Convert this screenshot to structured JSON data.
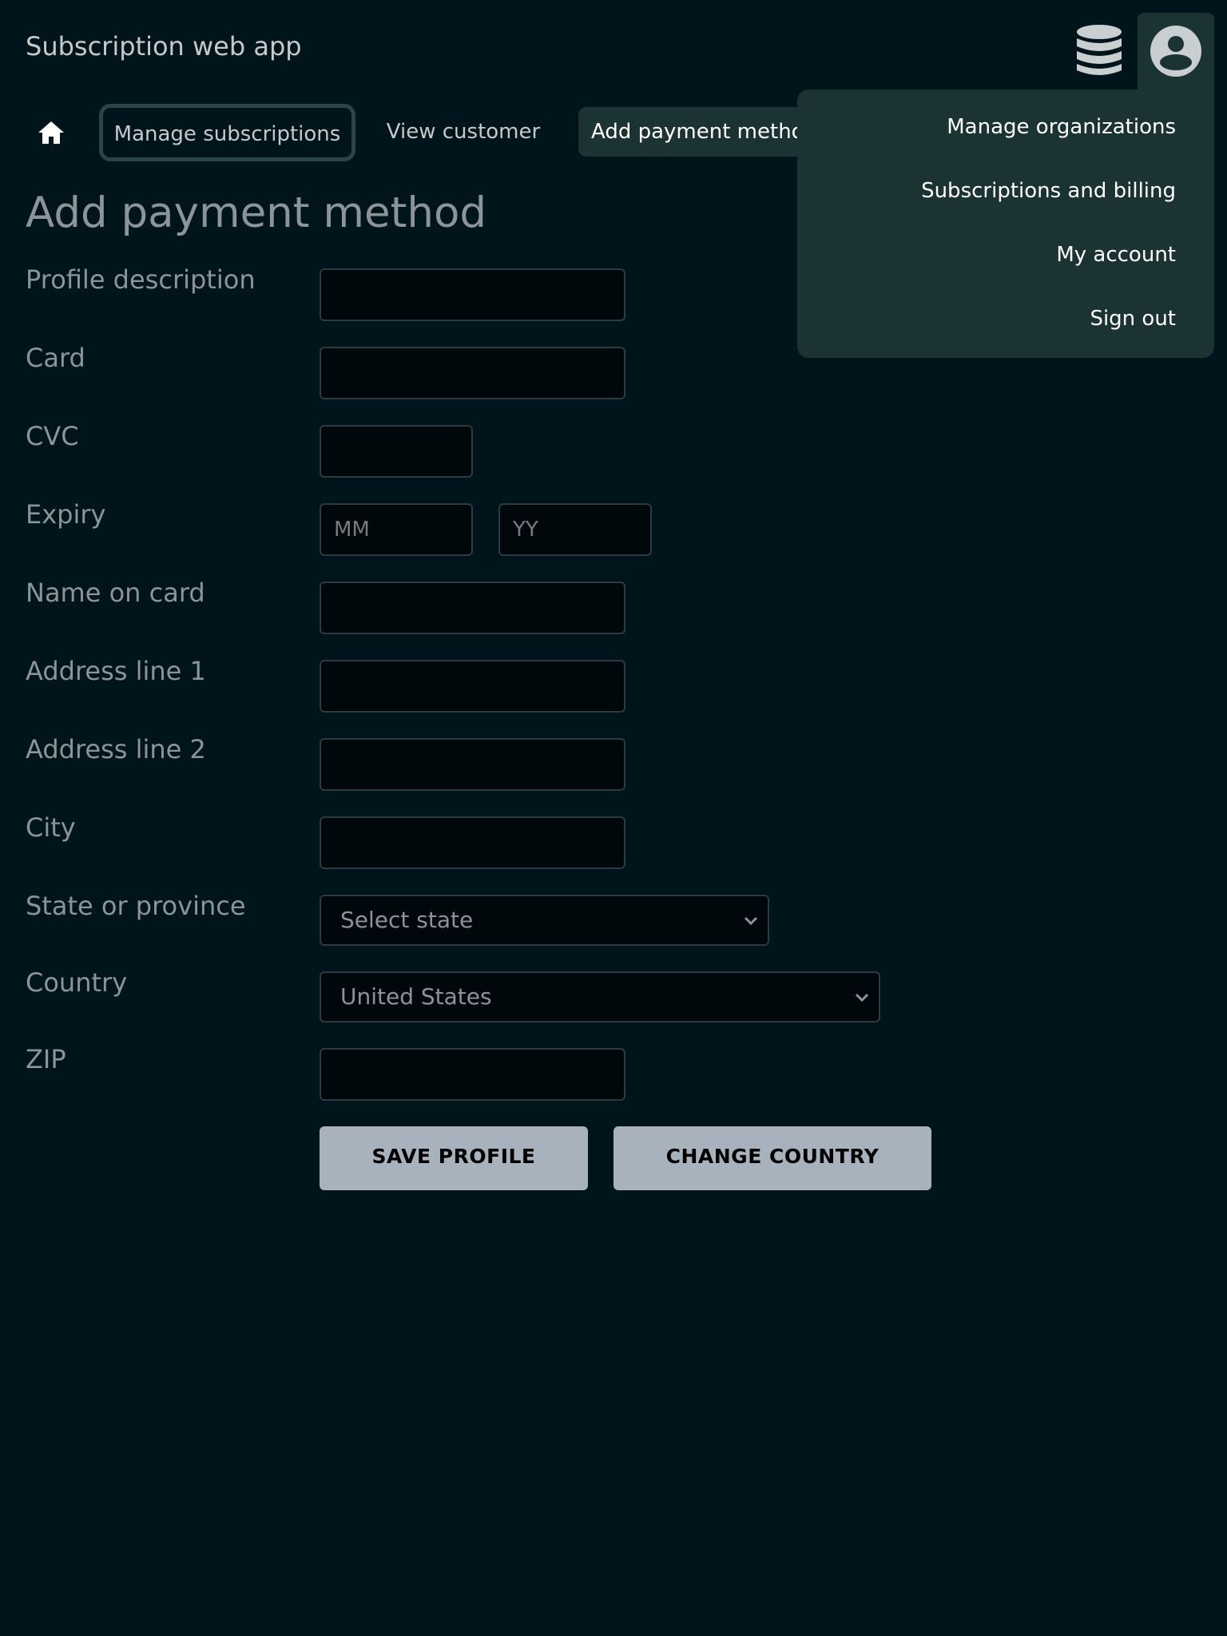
{
  "header": {
    "app_title": "Subscription web app",
    "icons": [
      "database-icon",
      "account-circle-icon"
    ]
  },
  "nav": {
    "home_icon": "home-icon",
    "tabs": [
      {
        "label": "Manage subscriptions"
      },
      {
        "label": "View customer"
      },
      {
        "label": "Add payment metho"
      }
    ]
  },
  "account_menu": {
    "items": [
      {
        "label": "Manage organizations"
      },
      {
        "label": "Subscriptions and billing"
      },
      {
        "label": "My account"
      },
      {
        "label": "Sign out"
      }
    ]
  },
  "form": {
    "title": "Add payment method",
    "labels": {
      "profile_description": "Profile description",
      "card": "Card",
      "cvc": "CVC",
      "expiry": "Expiry",
      "name_on_card": "Name on card",
      "address_line_1": "Address line 1",
      "address_line_2": "Address line 2",
      "city": "City",
      "state": "State or province",
      "country": "Country",
      "zip": "ZIP"
    },
    "values": {
      "profile_description": "",
      "card": "",
      "cvc": "",
      "expiry_month": "",
      "expiry_year": "",
      "name_on_card": "",
      "address_line_1": "",
      "address_line_2": "",
      "city": "",
      "zip": ""
    },
    "placeholders": {
      "expiry_month": "MM",
      "expiry_year": "YY"
    },
    "state_select": "Select state",
    "country_select": "United States",
    "buttons": {
      "save": "SAVE PROFILE",
      "change_country": "CHANGE COUNTRY"
    }
  },
  "colors": {
    "background": "#00141b",
    "panel": "#1c3334",
    "button": "#a8b2bd",
    "muted_text": "#8a9499"
  }
}
